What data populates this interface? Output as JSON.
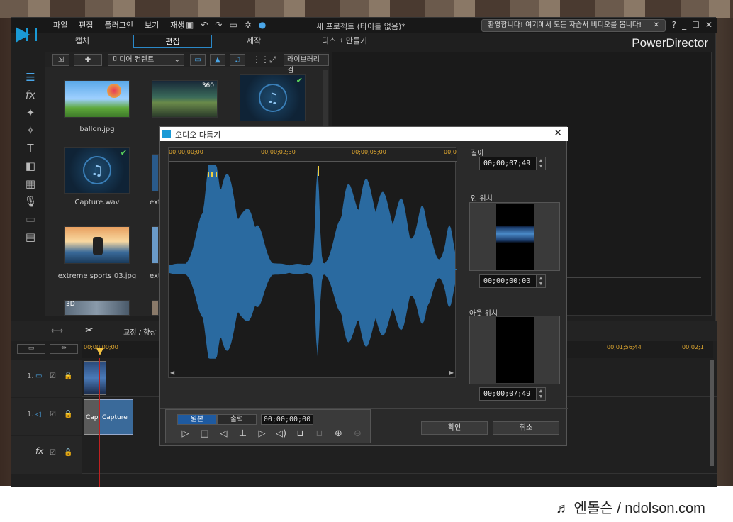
{
  "app": {
    "menu": [
      "파일",
      "편집",
      "플러그인",
      "보기",
      "재생"
    ],
    "project_title": "새 프로젝트 (타이틀 없음)*",
    "welcome_text": "환영합니다! 여기에서 모든 자습서 비디오를 봅니다!",
    "brand": "PowerDirector",
    "modes": [
      "캡처",
      "편집",
      "제작",
      "디스크 만들기"
    ],
    "active_mode": "편집"
  },
  "media": {
    "dropdown": "미디어 컨텐트",
    "search_label": "라이브러리 검",
    "items": [
      {
        "label": "ballon.jpg"
      },
      {
        "label": "Capture.wav"
      },
      {
        "label": "extreme sports 03.jpg"
      },
      {
        "label": "ext"
      },
      {
        "label": "ext"
      }
    ],
    "badge_360": "360",
    "badge_3d": "3D"
  },
  "timeline": {
    "tool_label": "교정 / 향상",
    "ruler_start": "00;00;00;00",
    "ruler_mid": "00;01;56;44",
    "ruler_end": "00;02;1",
    "tracks": [
      {
        "label": "1."
      },
      {
        "label": "1."
      },
      {
        "label": "fx"
      }
    ],
    "clip_audio_1": "Cap",
    "clip_audio_2": "Capture"
  },
  "dialog": {
    "title": "오디오 다듬기",
    "ruler": [
      "00;00;00;00",
      "00;00;02;30",
      "00;00;05;00",
      "00;0"
    ],
    "length_label": "길이",
    "length_value": "00;00;07;49",
    "in_label": "인 위치",
    "in_value": "00;00;00;00",
    "out_label": "아웃 위치",
    "out_value": "00;00;07;49",
    "seg_original": "원본",
    "seg_output": "출력",
    "current_time": "00;00;00;00",
    "ok": "확인",
    "cancel": "취소"
  },
  "watermark": "♬ 엔돌슨 / ndolson.com"
}
